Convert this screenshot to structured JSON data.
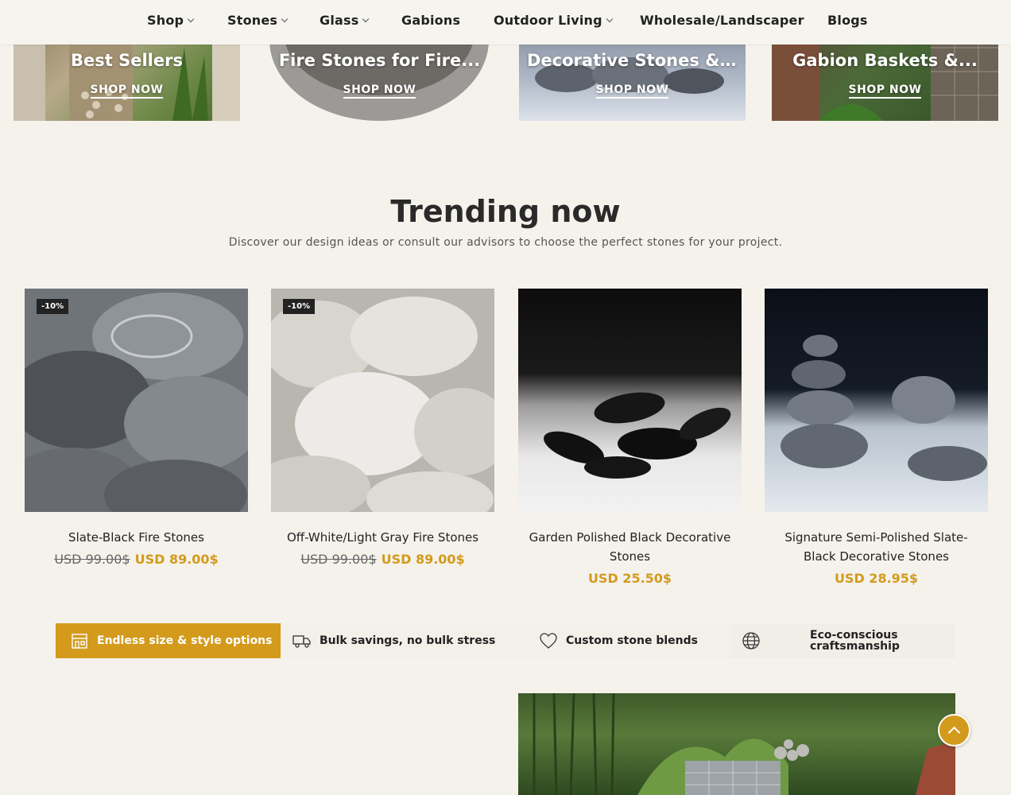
{
  "nav": {
    "items": [
      {
        "label": "Shop",
        "dropdown": true
      },
      {
        "label": "Stones",
        "dropdown": true
      },
      {
        "label": "Glass",
        "dropdown": true
      },
      {
        "label": "Gabions",
        "dropdown": false
      },
      {
        "label": "Outdoor Living",
        "dropdown": true
      },
      {
        "label": "Wholesale/Landscaper",
        "dropdown": false
      },
      {
        "label": "Blogs",
        "dropdown": false
      }
    ]
  },
  "categories": [
    {
      "title": "Best Sellers",
      "link": "SHOP NOW"
    },
    {
      "title": "Fire Stones for Fire...",
      "link": "SHOP NOW"
    },
    {
      "title": "Decorative Stones &...",
      "link": "SHOP NOW"
    },
    {
      "title": "Gabion Baskets &...",
      "link": "SHOP NOW"
    }
  ],
  "trending": {
    "title": "Trending now",
    "subtitle": "Discover our design ideas or consult our advisors to choose the perfect stones for your project."
  },
  "products": [
    {
      "name": "Slate-Black Fire Stones",
      "badge": "-10%",
      "old_price": "USD 99.00$",
      "price": "USD 89.00$"
    },
    {
      "name": "Off-White/Light Gray Fire Stones",
      "badge": "-10%",
      "old_price": "USD 99.00$",
      "price": "USD 89.00$"
    },
    {
      "name": "Garden Polished Black Decorative Stones",
      "badge": "",
      "old_price": "",
      "price": "USD 25.50$"
    },
    {
      "name": "Signature Semi-Polished Slate-Black Decorative Stones",
      "badge": "",
      "old_price": "",
      "price": "USD 28.95$"
    }
  ],
  "features": [
    {
      "label": "Endless size & style options",
      "icon": "storefront-icon",
      "active": true
    },
    {
      "label": "Bulk savings, no bulk stress",
      "icon": "truck-icon",
      "active": false
    },
    {
      "label": "Custom stone blends",
      "icon": "heart-icon",
      "active": false
    },
    {
      "label": "Eco-conscious craftsmanship",
      "icon": "globe-icon",
      "active": false
    }
  ],
  "colors": {
    "accent": "#d39a1c",
    "background": "#f5f2ec",
    "badge": "#222222"
  }
}
